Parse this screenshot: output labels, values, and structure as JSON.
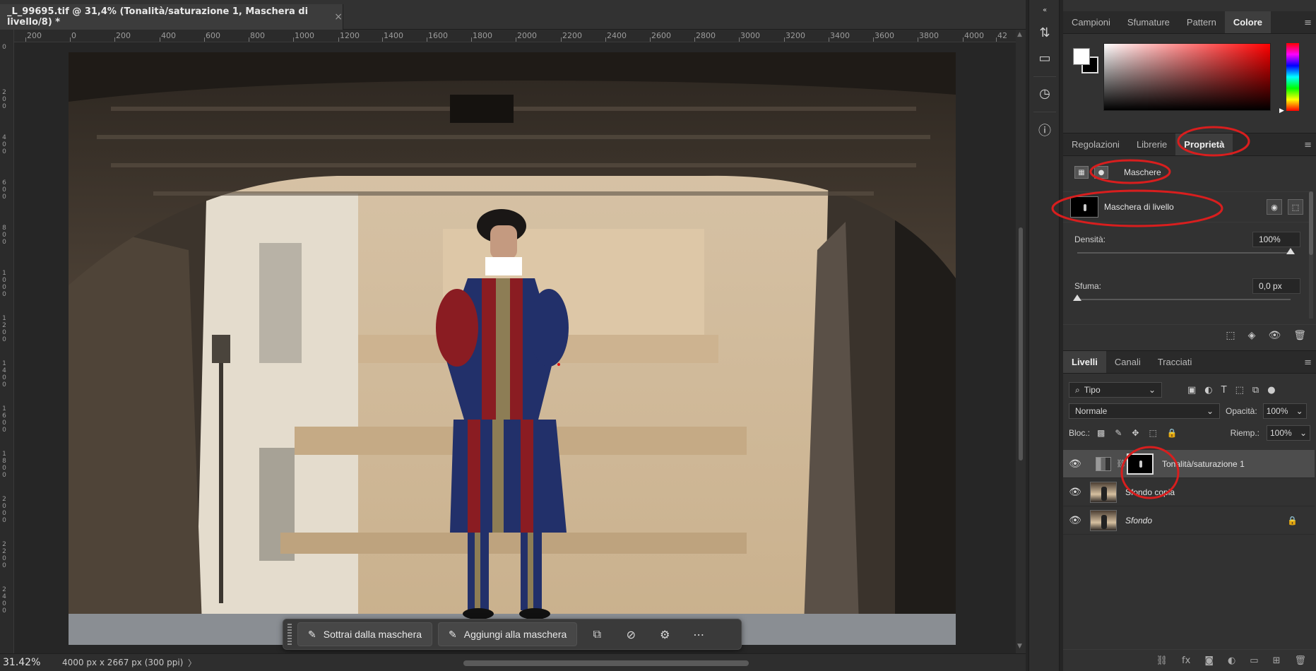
{
  "document": {
    "tab_title": "_L_99695.tif @ 31,4% (Tonalità/saturazione 1, Maschera di livello/8) *",
    "close_glyph": "×"
  },
  "rulers": {
    "top": [
      "200",
      "0",
      "200",
      "400",
      "600",
      "800",
      "1000",
      "1200",
      "1400",
      "1600",
      "1800",
      "2000",
      "2200",
      "2400",
      "2600",
      "2800",
      "3000",
      "3200",
      "3400",
      "3600",
      "3800",
      "4000",
      "42"
    ],
    "left": [
      "0",
      "200",
      "400",
      "600",
      "800",
      "1000",
      "1200",
      "1400",
      "1600",
      "1800",
      "2000",
      "2200",
      "2400"
    ]
  },
  "taskbar": {
    "subtract_label": "Sottrai dalla maschera",
    "add_label": "Aggiungi alla maschera",
    "more_glyph": "⋯"
  },
  "statusbar": {
    "zoom": "31.42%",
    "doc_info": "4000 px x 2667 px (300 ppi)",
    "arrow": "〉"
  },
  "color_panel": {
    "tabs": [
      "Campioni",
      "Sfumature",
      "Pattern",
      "Colore"
    ],
    "active_tab": "Colore",
    "foreground": "#ffffff",
    "background": "#000000"
  },
  "properties_panel": {
    "tabs": [
      "Regolazioni",
      "Librerie",
      "Proprietà"
    ],
    "active_tab": "Proprietà",
    "section": "Maschere",
    "mask_label": "Maschera di livello",
    "density_label": "Densità:",
    "density_value": "100%",
    "feather_label": "Sfuma:",
    "feather_value": "0,0 px"
  },
  "layers_panel": {
    "tabs": [
      "Livelli",
      "Canali",
      "Tracciati"
    ],
    "active_tab": "Livelli",
    "filter": "Tipo",
    "blend_mode": "Normale",
    "opacity_label": "Opacità:",
    "opacity_value": "100%",
    "lock_label": "Bloc.:",
    "fill_label": "Riemp.:",
    "fill_value": "100%",
    "layers": [
      {
        "name": "Tonalità/saturazione 1",
        "selected": true
      },
      {
        "name": "Sfondo copia",
        "selected": false
      },
      {
        "name": "Sfondo",
        "selected": false,
        "locked": true
      }
    ]
  },
  "annotation_color": "#d81e1e"
}
